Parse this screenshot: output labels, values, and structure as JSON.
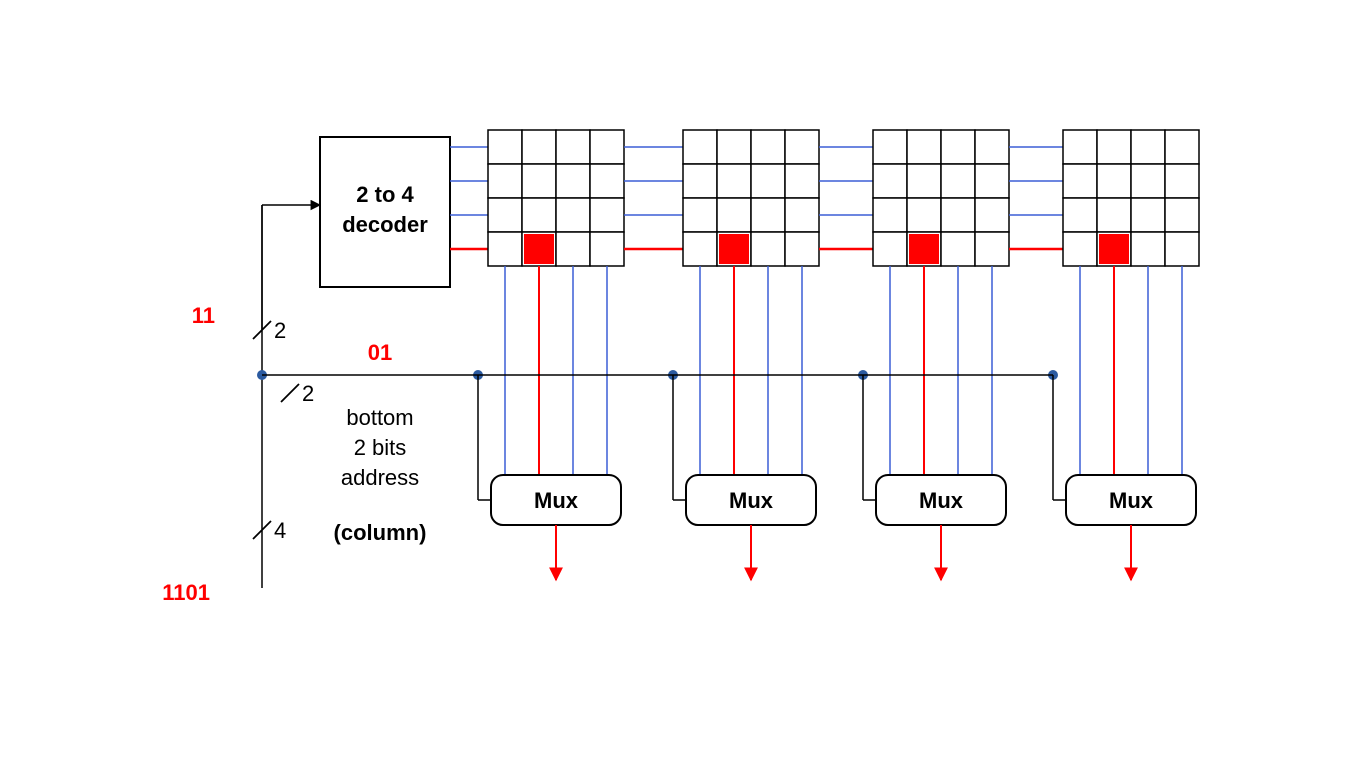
{
  "decoder_label_l1": "2 to 4",
  "decoder_label_l2": "decoder",
  "row_select_bits": "11",
  "col_select_bits": "01",
  "full_address": "1101",
  "bus_width_top": "2",
  "bus_width_mid": "2",
  "bus_width_bot": "4",
  "mux_label": "Mux",
  "caption_l1": "bottom",
  "caption_l2": "2 bits",
  "caption_l3": "address",
  "caption_l4": "(column)",
  "arrays": 4,
  "grid_rows": 4,
  "grid_cols": 4,
  "selected_row_index": 3,
  "selected_col_index": 1
}
